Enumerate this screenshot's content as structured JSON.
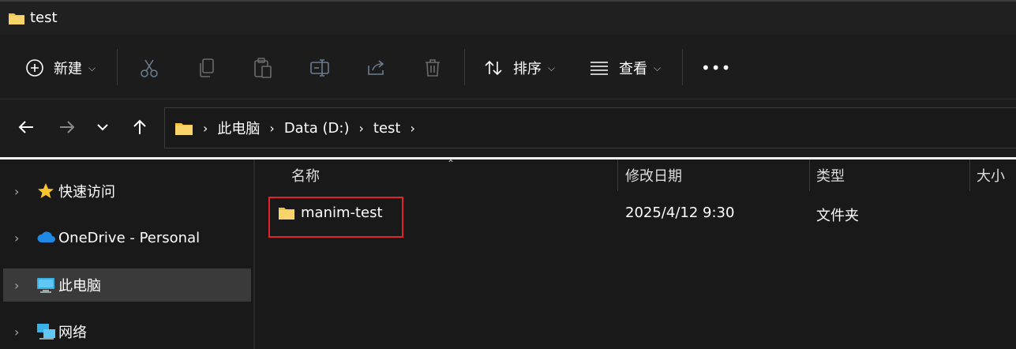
{
  "window": {
    "title": "test"
  },
  "toolbar": {
    "new_label": "新建",
    "sort_label": "排序",
    "view_label": "查看",
    "more_label": "•••"
  },
  "nav": {
    "breadcrumbs": [
      "此电脑",
      "Data (D:)",
      "test"
    ]
  },
  "sidebar": {
    "items": [
      {
        "label": "快速访问",
        "icon": "star-icon"
      },
      {
        "label": "OneDrive - Personal",
        "icon": "cloud-icon"
      },
      {
        "label": "此电脑",
        "icon": "monitor-icon",
        "selected": true
      },
      {
        "label": "网络",
        "icon": "network-icon"
      }
    ]
  },
  "columns": [
    "名称",
    "修改日期",
    "类型",
    "大小"
  ],
  "files": [
    {
      "name": "manim-test",
      "modified": "2025/4/12 9:30",
      "type": "文件夹",
      "size": ""
    }
  ],
  "colors": {
    "folder": "#f5c342",
    "highlight": "#e0242c",
    "background": "#191919"
  }
}
